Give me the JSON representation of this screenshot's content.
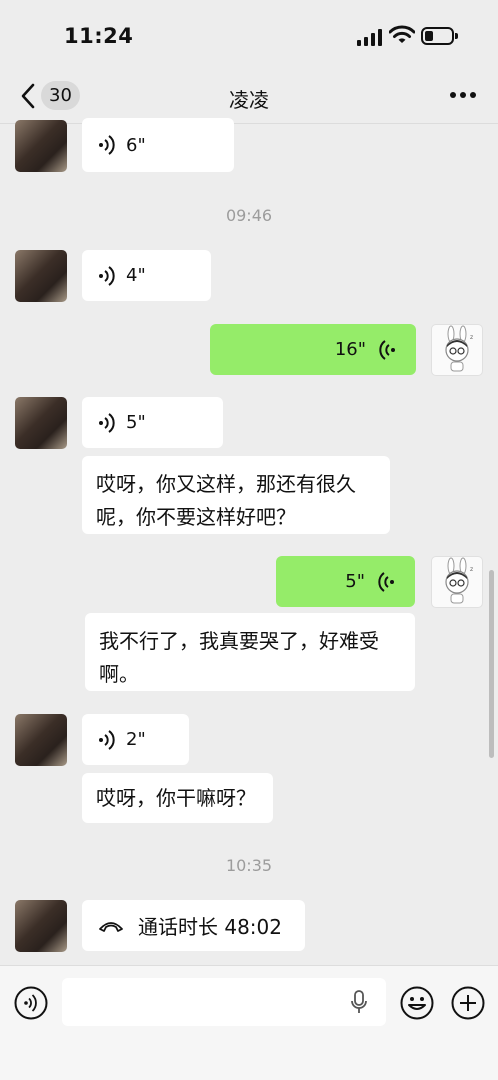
{
  "status_bar": {
    "time": "11:24"
  },
  "nav": {
    "unread_count": "30",
    "title": "凌凌"
  },
  "messages": {
    "m1": {
      "duration": "6\""
    },
    "t1": "09:46",
    "m2": {
      "duration": "4\""
    },
    "m3": {
      "duration": "16\""
    },
    "m4": {
      "duration": "5\""
    },
    "m5": {
      "line1": "哎呀，你又这样，那还有很久",
      "line2": "呢，你不要这样好吧？"
    },
    "m6": {
      "duration": "5\""
    },
    "m7": {
      "line1": "我不行了，我真要哭了，好难受",
      "line2": "啊。"
    },
    "m8": {
      "duration": "2\""
    },
    "m9": {
      "text": "哎呀，你干嘛呀？"
    },
    "t2": "10:35",
    "m10": {
      "text": "通话时长 48:02"
    }
  },
  "input_bar": {
    "placeholder": ""
  },
  "colors": {
    "background": "#ededed",
    "incoming_bubble": "#ffffff",
    "outgoing_bubble": "#95ec69",
    "timestamp": "#9c9c9c"
  },
  "icons": [
    "back-arrow",
    "more-dots",
    "voice-wave",
    "phone",
    "microphone",
    "emoji",
    "plus"
  ]
}
